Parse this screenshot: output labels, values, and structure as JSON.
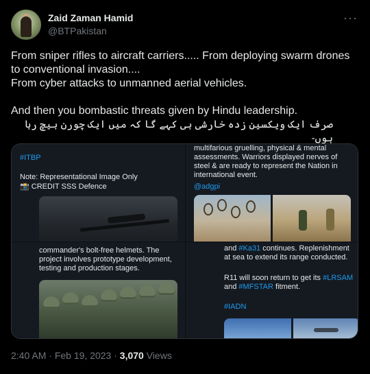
{
  "author": {
    "display_name": "Zaid Zaman Hamid",
    "handle": "@BTPakistan"
  },
  "more_icon": "more-horizontal-icon",
  "tweet": {
    "line1": "From sniper rifles to aircraft carriers..... From deploying swarm drones to conventional invasion....",
    "line2": "From cyber attacks to unmanned aerial vehicles.",
    "line3": "And then you bombastic threats given by Hindu leadership.",
    "line4_urdu": "صرف ایک ویکسین زدہ خارشی ہی کہے گا کہ میں ایک چورن بیچ رہا ہوں-"
  },
  "media": {
    "top_left": {
      "hashtag": "#ITBP",
      "note": "Note: Representational Image Only",
      "credit": "📸 CREDIT SSS Defence"
    },
    "top_right": {
      "text": "multifarious gruelling, physical & mental assessments. Warriors displayed nerves of steel & are ready to represent the Nation in international event.",
      "mention": "@adgpi"
    },
    "bottom_left": {
      "text": "commander's bolt-free helmets. The project involves prototype development, testing and production stages."
    },
    "bottom_right": {
      "text1_prefix": "and ",
      "text1_tag": "#Ka31",
      "text1_suffix": " continues. Replenishment at sea to extend its range conducted.",
      "text2_prefix": "R11 will soon return to get its ",
      "text2_tag1": "#LRSAM",
      "text2_mid": " and ",
      "text2_tag2": "#MFSTAR",
      "text2_suffix": " fitment.",
      "hashtag": "#IADN"
    }
  },
  "footer": {
    "time": "2:40 AM",
    "sep": " · ",
    "date": "Feb 19, 2023",
    "views_count": "3,070",
    "views_label": " Views"
  }
}
